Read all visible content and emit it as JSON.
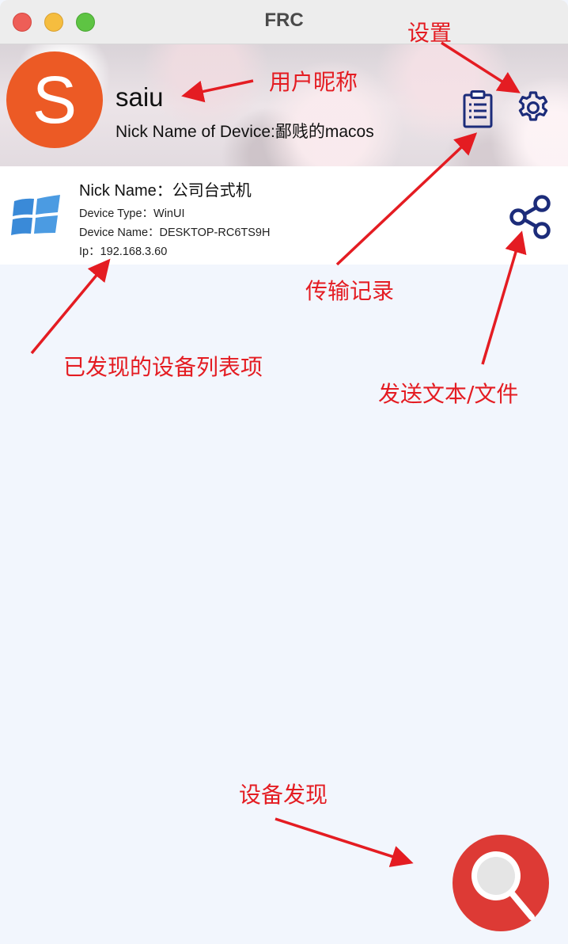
{
  "window": {
    "title": "FRC"
  },
  "user": {
    "avatar_letter": "S",
    "name": "saiu",
    "device_nick_line": "Nick Name of Device:鄙贱的macos",
    "avatar_color": "#ec5a25"
  },
  "toolbar": {
    "history_icon": "clipboard-list-icon",
    "settings_icon": "gear-icon"
  },
  "devices": [
    {
      "nick_line": "Nick Name：公司台式机",
      "type_line": "Device Type：WinUI",
      "name_line": "Device Name：DESKTOP-RC6TS9H",
      "ip_line": "Ip：192.168.3.60",
      "os_icon": "windows-logo-icon",
      "action_icon": "share-icon"
    }
  ],
  "fab": {
    "icon": "search-icon",
    "color": "#dd3a35"
  },
  "annotations": {
    "settings": "设置",
    "nickname": "用户昵称",
    "history": "传输记录",
    "device_item": "已发现的设备列表项",
    "send": "发送文本/文件",
    "discover": "设备发现",
    "color": "#e41c22"
  },
  "theme": {
    "accent": "#1c2c7a",
    "background": "#f2f6fd"
  }
}
